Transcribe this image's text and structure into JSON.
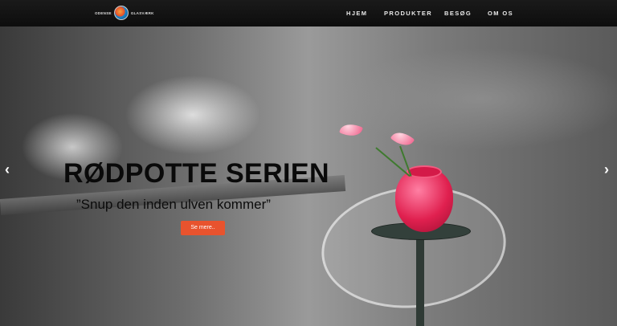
{
  "logo": {
    "left_text": "ODENSE",
    "right_text": "GLASVÆRK"
  },
  "nav": {
    "items": [
      {
        "label": "HJEM"
      },
      {
        "label": "PRODUKTER"
      },
      {
        "label": "BESØG"
      },
      {
        "label": "OM OS"
      }
    ]
  },
  "hero": {
    "title": "RØDPOTTE SERIEN",
    "subtitle": "”Snup den inden ulven kommer”",
    "button_label": "Se mere..",
    "prev_arrow": "‹",
    "next_arrow": "›"
  },
  "colors": {
    "accent": "#e8532e",
    "navbar": "#111111",
    "vase": "#e0204f"
  }
}
